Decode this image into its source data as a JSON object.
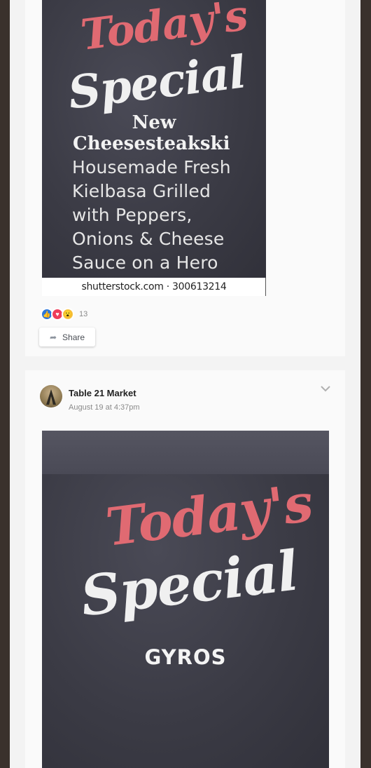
{
  "post1": {
    "image": {
      "headline_top": "Today's",
      "headline_bottom": "Special",
      "new_label": "New",
      "item_name": "Cheesesteakski",
      "description_lines": [
        "Housemade Fresh",
        "Kielbasa Grilled",
        "with Peppers,",
        "Onions & Cheese",
        "Sauce on a Hero"
      ],
      "watermark": "shutterstock.com · 300613214"
    },
    "reactions": {
      "icons": [
        "like-icon",
        "love-icon",
        "wow-icon"
      ],
      "count": "13"
    },
    "share_label": "Share"
  },
  "post2": {
    "author": "Table 21 Market",
    "timestamp": "August 19 at 4:37pm",
    "image": {
      "headline_top": "Today's",
      "headline_bottom": "Special",
      "dish": "GYROS"
    }
  },
  "colors": {
    "background": "#3a312c",
    "card": "#fafafa",
    "accent_pink": "#e06a72",
    "chalkboard": "#3b3b45"
  }
}
